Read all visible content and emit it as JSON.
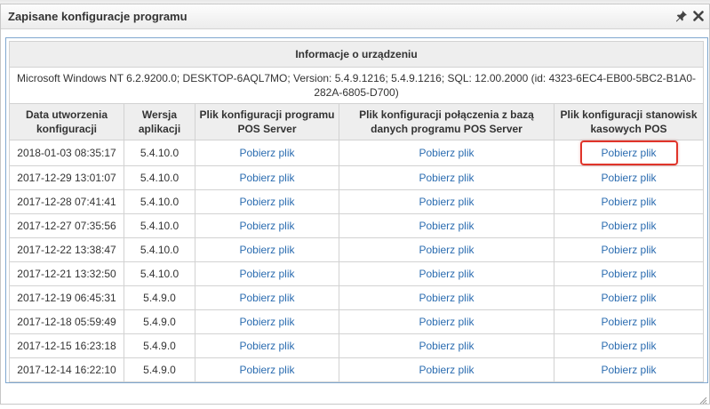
{
  "dialog": {
    "title": "Zapisane konfiguracje programu",
    "icons": [
      "pin-icon",
      "close-icon"
    ]
  },
  "info": {
    "header": "Informacje o urządzeniu",
    "text": "Microsoft Windows NT 6.2.9200.0; DESKTOP-6AQL7MO; Version: 5.4.9.1216; 5.4.9.1216; SQL: 12.00.2000 (id: 4323-6EC4-EB00-5BC2-B1A0-282A-6805-D700)"
  },
  "columns": [
    "Data utworzenia konfiguracji",
    "Wersja aplikacji",
    "Plik konfiguracji programu POS Server",
    "Plik konfiguracji połączenia z bazą danych programu POS Server",
    "Plik konfiguracji stanowisk kasowych POS"
  ],
  "link_label": "Pobierz plik",
  "highlight_color": "#e0342a",
  "link_color": "#2b6cb0",
  "rows": [
    {
      "date": "2018-01-03 08:35:17",
      "version": "5.4.10.0"
    },
    {
      "date": "2017-12-29 13:01:07",
      "version": "5.4.10.0"
    },
    {
      "date": "2017-12-28 07:41:41",
      "version": "5.4.10.0"
    },
    {
      "date": "2017-12-27 07:35:56",
      "version": "5.4.10.0"
    },
    {
      "date": "2017-12-22 13:38:47",
      "version": "5.4.10.0"
    },
    {
      "date": "2017-12-21 13:32:50",
      "version": "5.4.10.0"
    },
    {
      "date": "2017-12-19 06:45:31",
      "version": "5.4.9.0"
    },
    {
      "date": "2017-12-18 05:59:49",
      "version": "5.4.9.0"
    },
    {
      "date": "2017-12-15 16:23:18",
      "version": "5.4.9.0"
    },
    {
      "date": "2017-12-14 16:22:10",
      "version": "5.4.9.0"
    }
  ]
}
